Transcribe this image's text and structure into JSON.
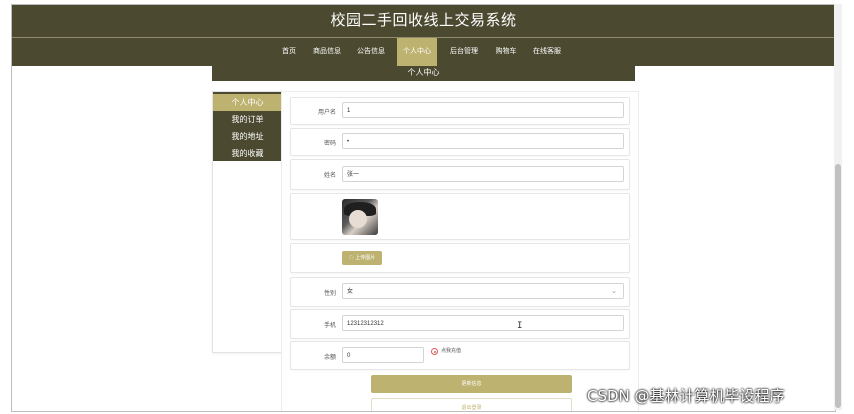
{
  "header": {
    "title": "校园二手回收线上交易系统"
  },
  "nav": {
    "items": [
      "首页",
      "商品信息",
      "公告信息",
      "个人中心",
      "后台管理",
      "购物车",
      "在线客服"
    ],
    "active_index": 3
  },
  "page": {
    "subtitle": "个人中心"
  },
  "sidebar": {
    "items": [
      "个人中心",
      "我的订单",
      "我的地址",
      "我的收藏"
    ],
    "active_index": 0
  },
  "form": {
    "username": {
      "label": "用户名",
      "value": "1"
    },
    "password": {
      "label": "密码",
      "value": "•"
    },
    "name": {
      "label": "姓名",
      "value": "张一"
    },
    "upload": {
      "label": "上传图片"
    },
    "gender": {
      "label": "性别",
      "value": "女"
    },
    "phone": {
      "label": "手机",
      "value": "12312312312"
    },
    "balance": {
      "label": "余额",
      "value": "0",
      "recharge_label": "点我充值"
    }
  },
  "actions": {
    "update": "更新信息",
    "logout": "退出登录"
  },
  "watermark": "CSDN @基林计算机毕设程序",
  "colors": {
    "nav_bg": "#4b4a31",
    "accent": "#bdb270"
  },
  "icons": {
    "upload": "upload-icon",
    "select": "chevron-down-icon",
    "cursor": "text-cursor-icon"
  }
}
